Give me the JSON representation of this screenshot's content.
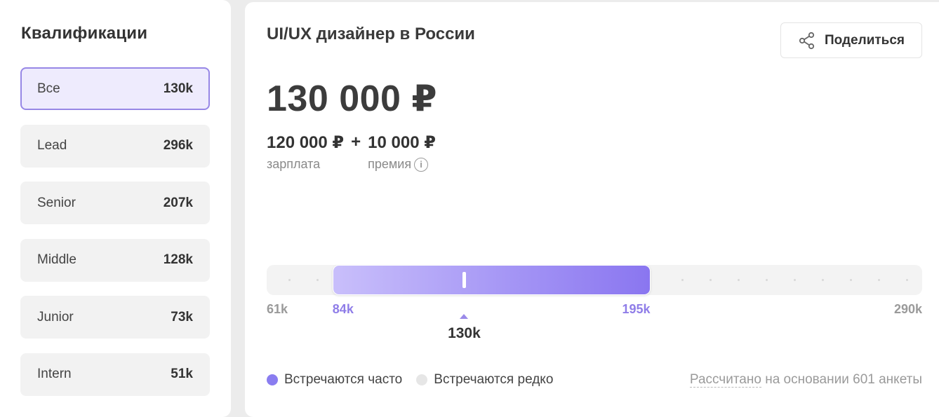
{
  "sidebar": {
    "title": "Квалификации",
    "items": [
      {
        "label": "Все",
        "count": "130k",
        "active": true
      },
      {
        "label": "Lead",
        "count": "296k",
        "active": false
      },
      {
        "label": "Senior",
        "count": "207k",
        "active": false
      },
      {
        "label": "Middle",
        "count": "128k",
        "active": false
      },
      {
        "label": "Junior",
        "count": "73k",
        "active": false
      },
      {
        "label": "Intern",
        "count": "51k",
        "active": false
      }
    ]
  },
  "main": {
    "title": "UI/UX дизайнер в России",
    "share_label": "Поделиться",
    "share_icon": "share-icon",
    "total": "130 000 ₽",
    "salary_value": "120 000 ₽",
    "salary_label": "зарплата",
    "plus": "+",
    "bonus_value": "10 000 ₽",
    "bonus_label": "премия",
    "info_icon": "info-icon"
  },
  "range": {
    "min_label": "61k",
    "low_label": "84k",
    "high_label": "195k",
    "max_label": "290k",
    "median_label": "130k",
    "min": 61,
    "low": 84,
    "high": 195,
    "max": 290,
    "median": 130
  },
  "legend": {
    "frequent": "Встречаются часто",
    "rare": "Встречаются редко",
    "frequent_color": "#8a7df0",
    "rare_color": "#e6e6e6"
  },
  "basis": {
    "link": "Рассчитано",
    "text": " на основании 601 анкеты"
  },
  "colors": {
    "accent": "#8f7de8",
    "active_bg": "#eeebfd",
    "active_border": "#9787e6"
  }
}
